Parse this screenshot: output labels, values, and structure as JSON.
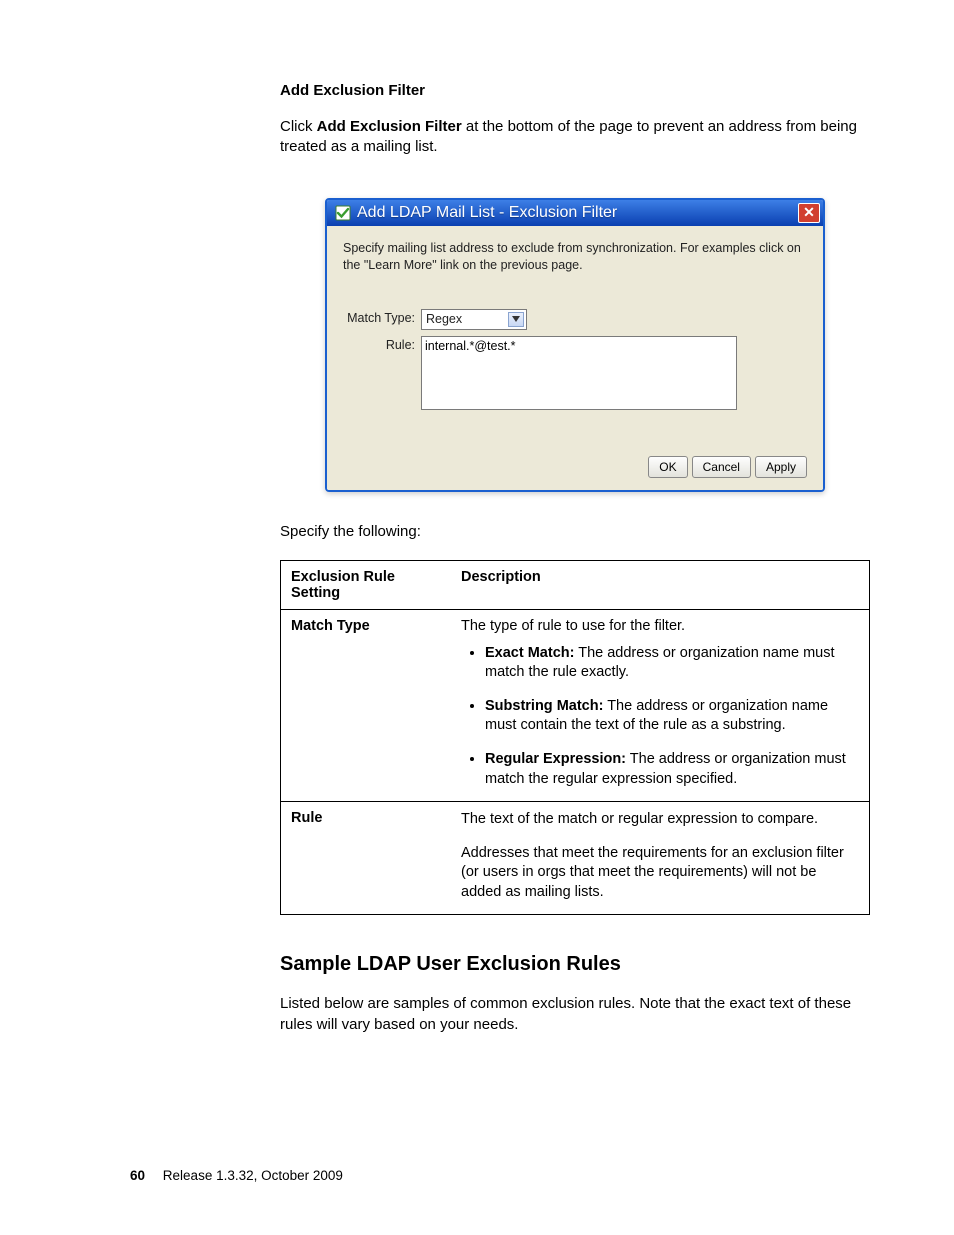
{
  "heading1": "Add Exclusion Filter",
  "intro": {
    "pre": "Click ",
    "bold": "Add Exclusion Filter",
    "post": " at the bottom of the page to prevent an address from being treated as a mailing list."
  },
  "dialog": {
    "title": "Add LDAP Mail List - Exclusion Filter",
    "close_glyph": "✕",
    "instruction": "Specify mailing list address to exclude from synchronization. For examples click on the \"Learn More\" link on the previous page.",
    "match_type_label": "Match Type:",
    "match_type_value": "Regex",
    "rule_label": "Rule:",
    "rule_value": "internal.*@test.*",
    "buttons": {
      "ok": "OK",
      "cancel": "Cancel",
      "apply": "Apply"
    }
  },
  "specify_text": "Specify the following:",
  "table": {
    "header": {
      "c1": "Exclusion Rule Setting",
      "c2": "Description"
    },
    "rows": [
      {
        "c1": "Match Type",
        "lead": "The type of rule to use for the filter.",
        "bullets": [
          {
            "b": "Exact Match:",
            "t": " The address or organization name must match the rule exactly."
          },
          {
            "b": "Substring Match:",
            "t": " The address or organization name must contain the text of the rule as a substring."
          },
          {
            "b": "Regular Expression:",
            "t": " The address or organization must match the regular expression specified."
          }
        ]
      },
      {
        "c1": "Rule",
        "paras": [
          "The text of the match or regular expression to compare.",
          "Addresses that meet the requirements for an exclusion filter (or users in orgs that meet the requirements) will not be added as mailing lists."
        ]
      }
    ]
  },
  "heading2": "Sample LDAP User Exclusion Rules",
  "body2": "Listed below are samples of common exclusion rules. Note that the exact text of these rules will vary based on your needs.",
  "footer": {
    "page": "60",
    "release": "Release 1.3.32, October 2009"
  }
}
